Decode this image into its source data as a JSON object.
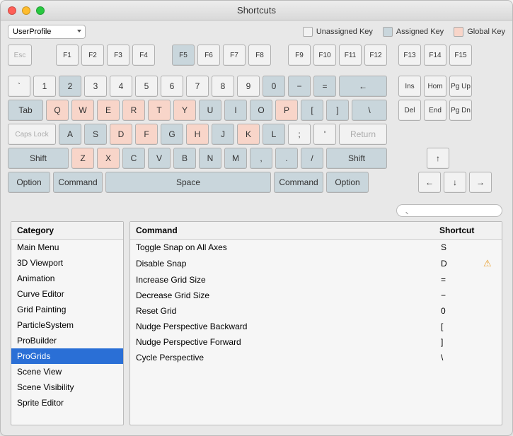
{
  "window": {
    "title": "Shortcuts"
  },
  "profile": {
    "value": "UserProfile"
  },
  "legend": {
    "unassigned": "Unassigned Key",
    "assigned": "Assigned Key",
    "global": "Global Key"
  },
  "keys": {
    "esc": "Esc",
    "f1": "F1",
    "f2": "F2",
    "f3": "F3",
    "f4": "F4",
    "f5": "F5",
    "f6": "F6",
    "f7": "F7",
    "f8": "F8",
    "f9": "F9",
    "f10": "F10",
    "f11": "F11",
    "f12": "F12",
    "f13": "F13",
    "f14": "F14",
    "f15": "F15",
    "backtick": "`",
    "n1": "1",
    "n2": "2",
    "n3": "3",
    "n4": "4",
    "n5": "5",
    "n6": "6",
    "n7": "7",
    "n8": "8",
    "n9": "9",
    "n0": "0",
    "minus": "−",
    "equal": "=",
    "back": "←",
    "ins": "Ins",
    "hom": "Hom",
    "pgup": "Pg Up",
    "tab": "Tab",
    "q": "Q",
    "w": "W",
    "e": "E",
    "r": "R",
    "t": "T",
    "y": "Y",
    "u": "U",
    "i": "I",
    "o": "O",
    "p": "P",
    "lbr": "[",
    "rbr": "]",
    "bslash": "\\",
    "del": "Del",
    "end": "End",
    "pgdn": "Pg Dn",
    "caps": "Caps Lock",
    "a": "A",
    "s": "S",
    "d": "D",
    "f": "F",
    "g": "G",
    "h": "H",
    "j": "J",
    "k": "K",
    "l": "L",
    "semi": ";",
    "apos": "'",
    "return": "Return",
    "shiftl": "Shift",
    "z": "Z",
    "x": "X",
    "c": "C",
    "v": "V",
    "b": "B",
    "n": "N",
    "m": "M",
    "comma": ",",
    "dot": ".",
    "slash": "/",
    "shiftr": "Shift",
    "optl": "Option",
    "cmdl": "Command",
    "space": "Space",
    "cmdr": "Command",
    "optr": "Option",
    "up": "↑",
    "left": "←",
    "down": "↓",
    "right": "→"
  },
  "search": {
    "placeholder": ""
  },
  "categoryHeader": "Category",
  "commandHeader": "Command",
  "shortcutHeader": "Shortcut",
  "categories": [
    {
      "label": "Main Menu"
    },
    {
      "label": "3D Viewport"
    },
    {
      "label": "Animation"
    },
    {
      "label": "Curve Editor"
    },
    {
      "label": "Grid Painting"
    },
    {
      "label": "ParticleSystem"
    },
    {
      "label": "ProBuilder"
    },
    {
      "label": "ProGrids",
      "selected": true
    },
    {
      "label": "Scene View"
    },
    {
      "label": "Scene Visibility"
    },
    {
      "label": "Sprite Editor"
    }
  ],
  "commands": [
    {
      "label": "Toggle Snap on All Axes",
      "shortcut": "S",
      "warn": false
    },
    {
      "label": "Disable Snap",
      "shortcut": "D",
      "warn": true
    },
    {
      "label": "Increase Grid Size",
      "shortcut": "=",
      "warn": false
    },
    {
      "label": "Decrease Grid Size",
      "shortcut": "−",
      "warn": false
    },
    {
      "label": "Reset Grid",
      "shortcut": "0",
      "warn": false
    },
    {
      "label": "Nudge Perspective Backward",
      "shortcut": "[",
      "warn": false
    },
    {
      "label": "Nudge Perspective Forward",
      "shortcut": "]",
      "warn": false
    },
    {
      "label": "Cycle Perspective",
      "shortcut": "\\",
      "warn": false
    }
  ]
}
